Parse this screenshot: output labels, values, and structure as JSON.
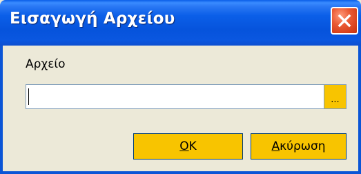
{
  "dialog": {
    "title": "Εισαγωγή Αρχείου",
    "field_label": "Αρχείο",
    "file_input_value": "",
    "browse_label": "...",
    "ok_label": "OK",
    "cancel_label": "Ακύρωση"
  },
  "icons": {
    "close": "close-icon"
  },
  "colors": {
    "titlebar": "#0653dc",
    "close_button": "#d43d18",
    "button_face": "#f8c400",
    "window_face": "#ece9d8"
  }
}
